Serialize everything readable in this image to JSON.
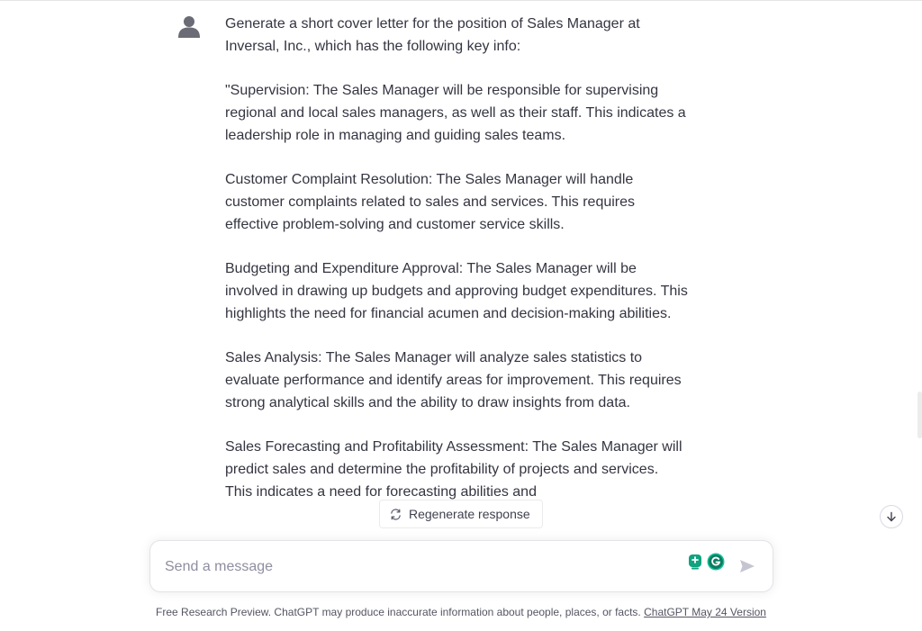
{
  "conversation": {
    "user_message": {
      "avatar_icon": "user-avatar-icon",
      "paragraphs": [
        "Generate a short cover letter for the position of Sales Manager at Inversal, Inc., which has the following key info:",
        "\"Supervision: The Sales Manager will be responsible for supervising regional and local sales managers, as well as their staff. This indicates a leadership role in managing and guiding sales teams.",
        "Customer Complaint Resolution: The Sales Manager will handle customer complaints related to sales and services. This requires effective problem-solving and customer service skills.",
        "Budgeting and Expenditure Approval: The Sales Manager will be involved in drawing up budgets and approving budget expenditures. This highlights the need for financial acumen and decision-making abilities.",
        "Sales Analysis: The Sales Manager will analyze sales statistics to evaluate performance and identify areas for improvement. This requires strong analytical skills and the ability to draw insights from data.",
        "Sales Forecasting and Profitability Assessment: The Sales Manager will predict sales and determine the profitability of projects and services. This indicates a need for forecasting abilities and"
      ]
    }
  },
  "controls": {
    "regenerate_label": "Regenerate response",
    "regenerate_icon": "refresh-icon",
    "scroll_down_icon": "arrow-down-icon"
  },
  "composer": {
    "placeholder": "Send a message",
    "send_icon": "send-icon",
    "extension_icons": [
      "plugin-badge-icon",
      "grammarly-icon"
    ]
  },
  "footer": {
    "text": "Free Research Preview. ChatGPT may produce inaccurate information about people, places, or facts.",
    "link_text": "ChatGPT May 24 Version"
  },
  "colors": {
    "text": "#343541",
    "placeholder": "#8e8ea0",
    "grammarly": "#15c39a",
    "plugin": "#10a37f"
  }
}
